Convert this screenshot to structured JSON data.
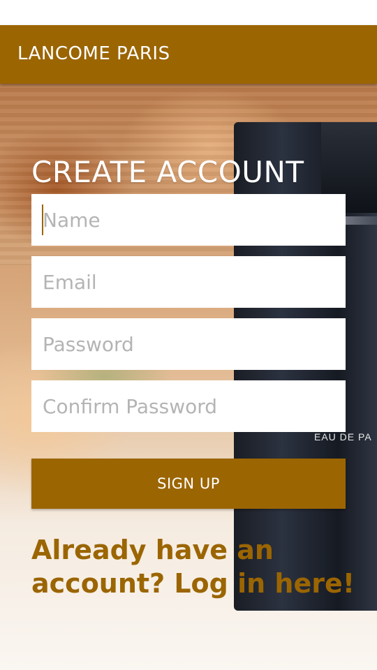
{
  "app_bar": {
    "title": "LANCOME PARIS"
  },
  "form": {
    "title": "CREATE ACCOUNT",
    "name_placeholder": "Name",
    "email_placeholder": "Email",
    "password_placeholder": "Password",
    "confirm_password_placeholder": "Confirm Password",
    "signup_label": "SIGN UP",
    "login_prompt": "Already have an account? Log in here!"
  },
  "background": {
    "bottle_label": "EAU DE PA"
  },
  "colors": {
    "accent": "#9b6502",
    "field_bg": "#ffffff",
    "placeholder": "#b4b4b4"
  }
}
